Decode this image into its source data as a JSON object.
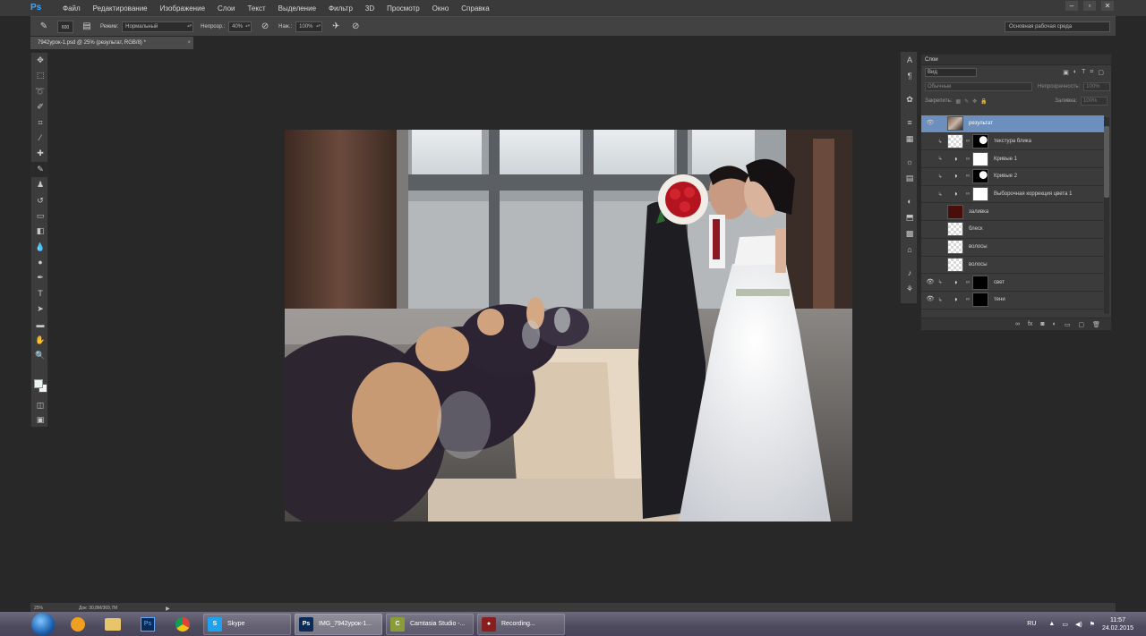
{
  "app": {
    "logo": "Ps"
  },
  "menu": [
    "Файл",
    "Редактирование",
    "Изображение",
    "Слои",
    "Текст",
    "Выделение",
    "Фильтр",
    "3D",
    "Просмотр",
    "Окно",
    "Справка"
  ],
  "window_controls": [
    "–",
    "▫",
    "✕"
  ],
  "options_bar": {
    "brush_size": "600",
    "mode_label": "Режим:",
    "mode_value": "Нормальный",
    "opacity_label": "Непрозр.:",
    "opacity_value": "40%",
    "flow_label": "Наж.:",
    "flow_value": "100%",
    "workspace": "Основная рабочая среда"
  },
  "document_tab": {
    "title": "7942урок-1.psd @ 25% (результат, RGB/8) *",
    "close": "×"
  },
  "status_bar": {
    "zoom": "25%",
    "doc_info": "Док: 30,8М/369,7М",
    "arrow": "▶"
  },
  "colors": {
    "foreground": "#e8f4f4",
    "background": "#f4f4f4",
    "selected_layer": "#6c8fbd"
  },
  "layers_panel": {
    "title": "Слои",
    "kind_filter": "Вид",
    "blend_mode": "Обычные",
    "opacity_label": "Непрозрачность:",
    "opacity_value": "100%",
    "lock_label": "Закрепить:",
    "fill_label": "Заливка:",
    "fill_value": "100%",
    "layers": [
      {
        "name": "результат",
        "thumb": "photo",
        "mask": "",
        "visible": true,
        "selected": true,
        "linked": false
      },
      {
        "name": "текстура блика",
        "thumb": "checker",
        "mask": "mask-lightshape",
        "visible": false,
        "selected": false,
        "linked": true
      },
      {
        "name": "Кривые 1",
        "thumb": "adjust",
        "mask": "white",
        "visible": false,
        "selected": false,
        "linked": true
      },
      {
        "name": "Кривые 2",
        "thumb": "adjust",
        "mask": "mask-lightshape",
        "visible": false,
        "selected": false,
        "linked": true
      },
      {
        "name": "Выборочная коррекция цвета 1",
        "thumb": "adjust",
        "mask": "white",
        "visible": false,
        "selected": false,
        "linked": true
      },
      {
        "name": "заливка",
        "thumb": "maroon",
        "mask": "",
        "visible": false,
        "selected": false,
        "linked": false
      },
      {
        "name": "блеск",
        "thumb": "checker",
        "mask": "",
        "visible": false,
        "selected": false,
        "linked": false
      },
      {
        "name": "волосы",
        "thumb": "checker",
        "mask": "",
        "visible": false,
        "selected": false,
        "linked": false
      },
      {
        "name": "волосы",
        "thumb": "checker",
        "mask": "",
        "visible": false,
        "selected": false,
        "linked": false
      },
      {
        "name": "свет",
        "thumb": "adjust",
        "mask": "black",
        "visible": true,
        "selected": false,
        "linked": true
      },
      {
        "name": "тени",
        "thumb": "adjust",
        "mask": "black",
        "visible": true,
        "selected": false,
        "linked": true
      }
    ]
  },
  "taskbar": {
    "tasks": [
      {
        "label": "Skype",
        "badge": "S",
        "badge_color": "#1fa2ec"
      },
      {
        "label": "IMG_7942урок-1...",
        "badge": "Ps",
        "badge_color": "#0a2b55"
      },
      {
        "label": "Camtasia Studio -...",
        "badge": "C",
        "badge_color": "#8a9c3a"
      },
      {
        "label": "Recording...",
        "badge": "●",
        "badge_color": "#8a1e1e"
      }
    ],
    "lang": "RU",
    "time": "11:57",
    "date": "24.02.2015"
  }
}
